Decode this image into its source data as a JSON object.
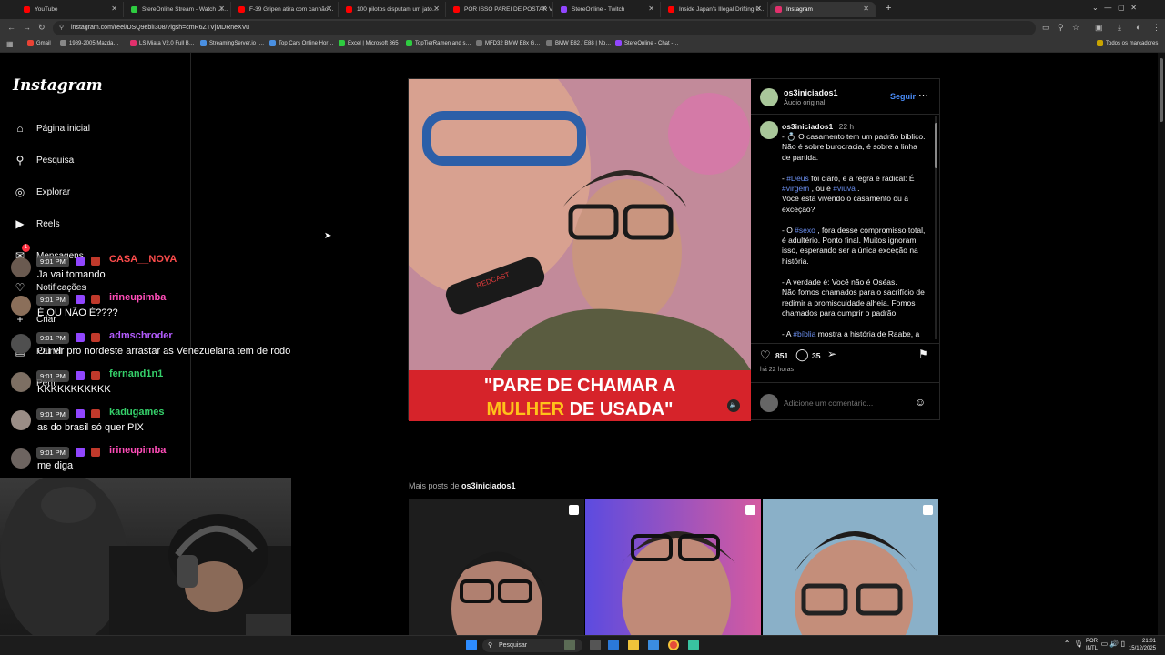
{
  "browser": {
    "tabs": [
      {
        "title": "YouTube",
        "color": "#ff0000",
        "active": false
      },
      {
        "title": "StereOnline Stream - Watch Li…",
        "color": "#2ecc40",
        "active": false
      },
      {
        "title": "F-39 Gripen atira com canhão…",
        "color": "#ff0000",
        "active": false
      },
      {
        "title": "100 pilotos disputam um jato…",
        "color": "#ff0000",
        "active": false
      },
      {
        "title": "POR ISSO PAREI DE POSTAR VÍ…",
        "color": "#ff0000",
        "active": false
      },
      {
        "title": "StereOnline - Twitch",
        "color": "#9146ff",
        "active": false
      },
      {
        "title": "Inside Japan's Illegal Drifting U…",
        "color": "#ff0000",
        "active": false
      },
      {
        "title": "Instagram",
        "color": "#e1306c",
        "active": true
      }
    ],
    "url": "instagram.com/reel/DSQ9ebiI308/?igsh=cmR6ZTVjMDRneXVu",
    "bookmarks": [
      {
        "label": "Gmail",
        "color": "#ea4335"
      },
      {
        "label": "1989-2005 Mazda…",
        "color": "#888888"
      },
      {
        "label": "LS Miata V2.0 Full B…",
        "color": "#e1306c"
      },
      {
        "label": "StreamingServer.io |…",
        "color": "#4a90e2"
      },
      {
        "label": "Top Cars Online Hor…",
        "color": "#4a90e2"
      },
      {
        "label": "Excel | Microsoft 365",
        "color": "#2ecc40"
      },
      {
        "label": "TopTierRamen and s…",
        "color": "#2ecc40"
      },
      {
        "label": "MFD32 BMW E8x G…",
        "color": "#777777"
      },
      {
        "label": "BMW E82 / E88 | No…",
        "color": "#777777"
      },
      {
        "label": "StereOnline - Chat -…",
        "color": "#9146ff"
      }
    ],
    "all_bookmarks": "Todos os marcadores"
  },
  "sidebar": {
    "logo": "Instagram",
    "items": [
      {
        "label": "Página inicial",
        "icon": "home-icon"
      },
      {
        "label": "Pesquisa",
        "icon": "search-icon"
      },
      {
        "label": "Explorar",
        "icon": "compass-icon"
      },
      {
        "label": "Reels",
        "icon": "reels-icon"
      },
      {
        "label": "Mensagens",
        "icon": "messenger-icon",
        "badge": "1"
      },
      {
        "label": "Notificações",
        "icon": "heart-icon"
      },
      {
        "label": "Criar",
        "icon": "plus-icon"
      },
      {
        "label": "Painel",
        "icon": "dashboard-icon"
      },
      {
        "label": "Perfil",
        "icon": "avatar"
      }
    ]
  },
  "chat": [
    {
      "time": "9:01 PM",
      "user": "CASA__NOVA",
      "color": "#ff4d4d",
      "message": "Ja vai tomando"
    },
    {
      "time": "9:01 PM",
      "user": "irineupimba",
      "color": "#ff4db8",
      "message": "É OU NÃO É????"
    },
    {
      "time": "9:01 PM",
      "user": "admschroder",
      "color": "#b45cff",
      "message": "Ou vir pro nordeste arrastar as Venezuelana tem de rodo"
    },
    {
      "time": "9:01 PM",
      "user": "fernand1n1",
      "color": "#35d06a",
      "message": "KKKKKKKKKKK"
    },
    {
      "time": "9:01 PM",
      "user": "kadugames",
      "color": "#35d06a",
      "message": "as do brasil só quer PIX"
    },
    {
      "time": "9:01 PM",
      "user": "irineupimba",
      "color": "#ff4db8",
      "message": "me diga"
    }
  ],
  "post": {
    "username": "os3iniciados1",
    "audio": "Áudio original",
    "follow": "Seguir",
    "time_ago": "22 h",
    "video_caption_line1": "\"PARE DE CHAMAR A",
    "video_caption_hl": "MULHER",
    "video_caption_line2": " DE USADA\"",
    "mic_brand": "REDCAST",
    "caption_parts": [
      "- 💍 O casamento tem um padrão bíblico. Não é sobre burocracia, é sobre a linha de partida.\n\n- ",
      "#Deus",
      " foi claro, e a regra é radical: É ",
      "#virgem",
      " , ou é ",
      "#viúva",
      " .\nVocê está vivendo o casamento ou a exceção?\n\n- O ",
      "#sexo",
      " , fora desse compromisso total, é adultério. Ponto final. Muitos ignoram isso, esperando ser a única exceção na história.\n\n- A verdade é: Você não é Oséas.\nNão fomos chamados para o sacrifício de redimir a promiscuidade alheia. Fomos chamados para cumprir o padrão.\n\n- A ",
      "#bíblia",
      " mostra a história de Raabe, a"
    ],
    "likes": "851",
    "comments": "35",
    "posted": "há 22 horas",
    "comment_placeholder": "Adicione um comentário..."
  },
  "more_posts": {
    "prefix": "Mais posts de ",
    "username": "os3iniciados1"
  },
  "taskbar": {
    "search_placeholder": "Pesquisar",
    "lang1": "POR",
    "lang2": "INTL",
    "time": "21:01",
    "date": "15/12/2025"
  }
}
